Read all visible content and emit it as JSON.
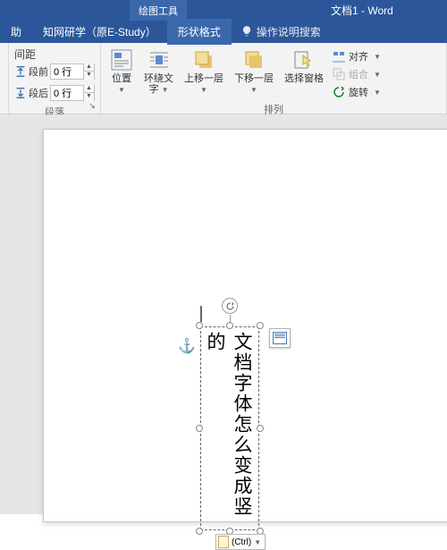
{
  "title": "文档1 - Word",
  "tool_context": "绘图工具",
  "tabs": {
    "help": "助",
    "estudy": "知网研学（原E-Study）",
    "format": "形状格式",
    "tellme": "操作说明搜索"
  },
  "ribbon": {
    "paragraph": {
      "spacing_label": "间距",
      "before_label": "段前",
      "before_value": "0 行",
      "after_label": "段后",
      "after_value": "0 行",
      "group_title": "段落"
    },
    "arrange": {
      "position": "位置",
      "wrap_l1": "环绕文",
      "wrap_l2": "字",
      "bring_forward": "上移一层",
      "send_backward": "下移一层",
      "selection_pane": "选择窗格",
      "align": "对齐",
      "group": "组合",
      "rotate": "旋转",
      "group_title": "排列"
    }
  },
  "doc": {
    "textbox_text": "文档字体怎么变成竖的",
    "ctrl_label": "(Ctrl)"
  }
}
